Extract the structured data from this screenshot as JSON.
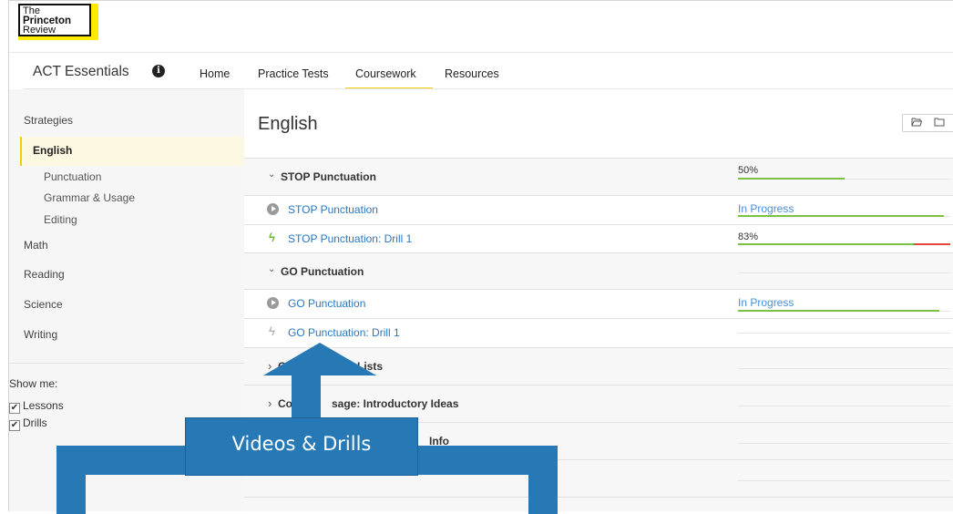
{
  "logo": {
    "line1": "The",
    "line2": "Princeton",
    "line3": "Review"
  },
  "course": {
    "title": "ACT Essentials",
    "info_icon": "i"
  },
  "nav": {
    "home": "Home",
    "practice_tests": "Practice Tests",
    "coursework": "Coursework",
    "resources": "Resources",
    "active": "Coursework"
  },
  "sidebar": {
    "strategies": "Strategies",
    "english": "English",
    "sub": [
      "Punctuation",
      "Grammar & Usage",
      "Editing"
    ],
    "math": "Math",
    "reading": "Reading",
    "science": "Science",
    "writing": "Writing",
    "show_me": "Show me:",
    "lessons": "Lessons",
    "drills": "Drills",
    "check": "✔"
  },
  "content": {
    "title": "English",
    "icons": [
      "folder-open-icon",
      "folder-icon"
    ],
    "rows": [
      {
        "type": "group",
        "label": "STOP Punctuation",
        "chevron": "⌄",
        "progress_text": "50%",
        "fill": 0.5
      },
      {
        "type": "lesson",
        "label": "STOP Punctuation",
        "progress_text": "In Progress",
        "fill": 0.97
      },
      {
        "type": "drill",
        "label": "STOP Punctuation: Drill 1",
        "progress_text": "83%",
        "fill": 0.83
      },
      {
        "type": "group",
        "label": "GO Punctuation",
        "chevron": "⌄"
      },
      {
        "type": "lesson",
        "label": "GO Punctuation",
        "progress_text": "In Progress",
        "fill": 0.95
      },
      {
        "type": "drill",
        "label": "GO Punctuation: Drill 1"
      },
      {
        "type": "group-collapsed",
        "label": "age: Lists",
        "label_prefix": "C",
        "chevron": "›"
      },
      {
        "type": "group-collapsed",
        "label": "sage: Introductory Ideas",
        "label_prefix": "Co",
        "chevron": "›"
      },
      {
        "type": "group-collapsed",
        "label": "Info"
      }
    ]
  },
  "colors": {
    "accent": "#f0d000",
    "link": "#2a78c2",
    "progress_green": "#7cc242",
    "progress_red": "#e8453c",
    "overlay": "#2779b6"
  },
  "overlay": {
    "label": "Videos & Drills"
  }
}
